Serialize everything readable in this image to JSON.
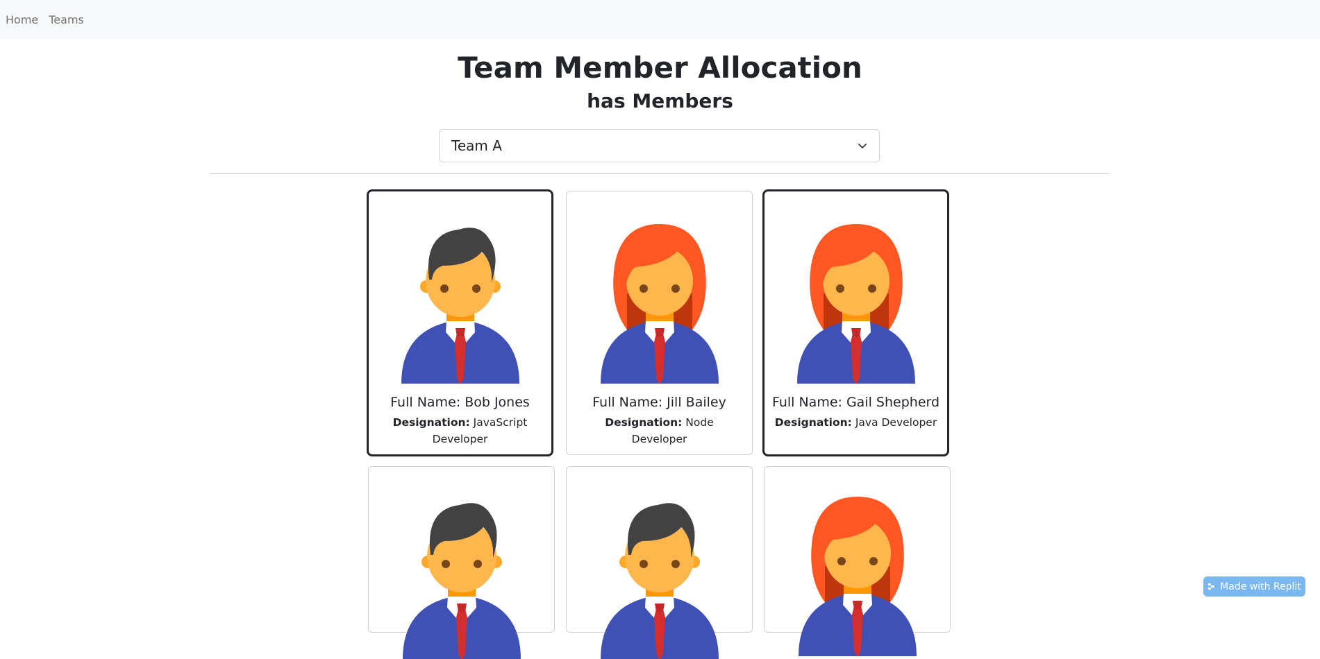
{
  "nav": {
    "items": [
      {
        "label": "Home"
      },
      {
        "label": "Teams"
      }
    ]
  },
  "header": {
    "title": "Team Member Allocation",
    "subtitle": "has Members"
  },
  "team_select": {
    "selected": "Team A"
  },
  "cards": [
    {
      "name": "Full Name: Bob Jones",
      "designation_label": "Designation:",
      "designation": "JavaScript Developer",
      "avatar": "male-avatar-icon",
      "selected": true
    },
    {
      "name": "Full Name: Jill Bailey",
      "designation_label": "Designation:",
      "designation": "Node Developer",
      "avatar": "female-avatar-icon",
      "selected": false
    },
    {
      "name": "Full Name: Gail Shepherd",
      "designation_label": "Designation:",
      "designation": "Java Developer",
      "avatar": "female-avatar-icon",
      "selected": true
    },
    {
      "avatar": "male-avatar-icon",
      "selected": false
    },
    {
      "avatar": "male-avatar-icon",
      "selected": false
    },
    {
      "avatar": "female-avatar-icon",
      "selected": false
    }
  ],
  "badge": {
    "label": "Made with Replit"
  },
  "colors": {
    "navbar_bg": "#f8f9fa",
    "selected_border": "#212529",
    "suit": "#3f51b5",
    "skin": "#ffb74d",
    "male_hair": "#424242",
    "female_hair": "#ff5722",
    "tie": "#d32f2f",
    "badge_bg": "#78b7f0"
  }
}
